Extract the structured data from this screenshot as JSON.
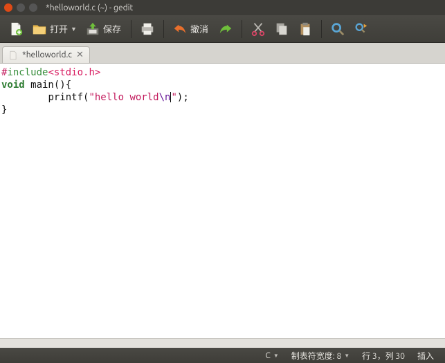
{
  "window": {
    "title": "*helloworld.c (~) - gedit"
  },
  "toolbar": {
    "open": "打开",
    "save": "保存",
    "undo": "撤消"
  },
  "tab": {
    "label": "*helloworld.c"
  },
  "code": {
    "hash": "#",
    "include": "include",
    "header": "<stdio.h>",
    "void": "void",
    "main_sig": " main(){",
    "indent": "        ",
    "printf": "printf(",
    "str_open": "\"hello world",
    "escape": "\\n",
    "str_close": "\"",
    "printf_end": ");",
    "close_brace": "}"
  },
  "status": {
    "lang": "C",
    "tabwidth_label": "制表符宽度: 8",
    "position": "行 3，列 30",
    "mode": "插入"
  }
}
